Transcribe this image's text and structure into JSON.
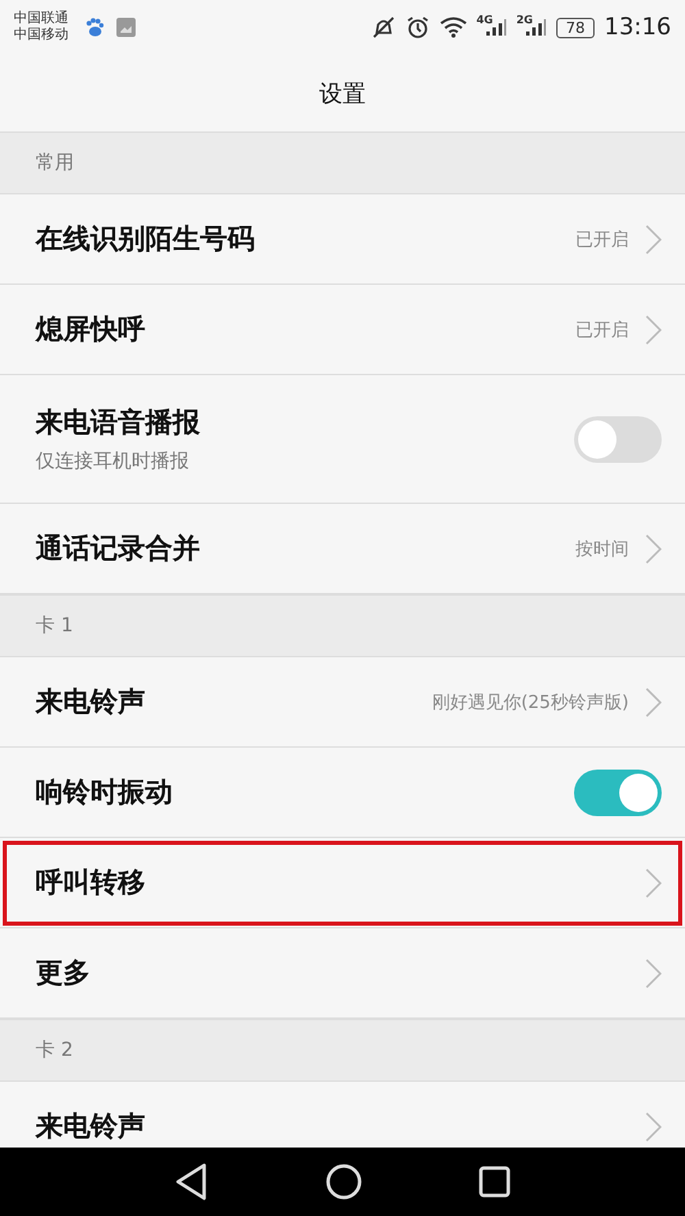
{
  "status_bar": {
    "carriers": [
      "中国联通",
      "中国移动"
    ],
    "signals": [
      {
        "network": "4G"
      },
      {
        "network": "2G"
      }
    ],
    "battery": "78",
    "time": "13:16"
  },
  "title": "设置",
  "sections": [
    {
      "header": "常用",
      "rows": [
        {
          "kind": "link",
          "title": "在线识别陌生号码",
          "value": "已开启",
          "highlighted": false
        },
        {
          "kind": "link",
          "title": "熄屏快呼",
          "value": "已开启",
          "highlighted": false
        },
        {
          "kind": "toggle",
          "title": "来电语音播报",
          "subtitle": "仅连接耳机时播报",
          "on": false,
          "highlighted": false
        },
        {
          "kind": "link",
          "title": "通话记录合并",
          "value": "按时间",
          "highlighted": false
        }
      ]
    },
    {
      "header": "卡 1",
      "rows": [
        {
          "kind": "link",
          "title": "来电铃声",
          "value": "刚好遇见你(25秒铃声版)",
          "highlighted": false
        },
        {
          "kind": "toggle",
          "title": "响铃时振动",
          "on": true,
          "highlighted": false
        },
        {
          "kind": "link",
          "title": "呼叫转移",
          "highlighted": true
        },
        {
          "kind": "link",
          "title": "更多",
          "highlighted": false
        }
      ]
    },
    {
      "header": "卡 2",
      "rows": [
        {
          "kind": "link",
          "title": "来电铃声",
          "highlighted": false
        }
      ]
    }
  ]
}
